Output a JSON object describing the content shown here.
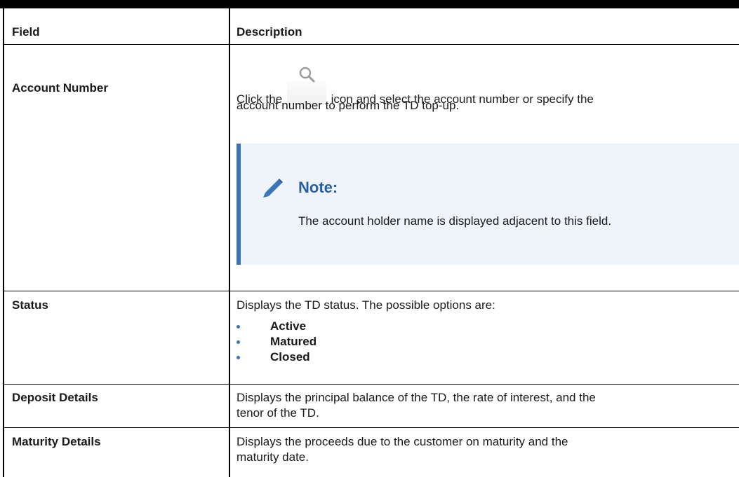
{
  "table": {
    "headers": {
      "field": "Field",
      "description": "Description"
    },
    "rows": [
      {
        "field": "Account Number",
        "desc_line1_before_icon": "Click the",
        "desc_line1_after_icon": "icon and select the account number or specify the",
        "desc_line2": "account number to perform the TD top-up.",
        "icon": "search-icon",
        "note": {
          "title": "Note:",
          "icon": "pencil-icon",
          "text": "The account holder name is displayed adjacent to this field.",
          "accent_color": "#3a74b8",
          "background_color": "#eef4fa",
          "title_color": "#2a5f9e"
        }
      },
      {
        "field": "Status",
        "desc": "Displays the TD status. The possible options are:",
        "options": [
          "Active",
          "Matured",
          "Closed"
        ]
      },
      {
        "field": "Deposit Details",
        "desc_line1": "Displays the principal balance of the TD, the rate of interest, and the",
        "desc_line2": "tenor of the TD."
      },
      {
        "field": "Maturity Details",
        "desc_line1": "Displays the proceeds due to the customer on maturity and the",
        "desc_line2": "maturity date."
      }
    ]
  }
}
